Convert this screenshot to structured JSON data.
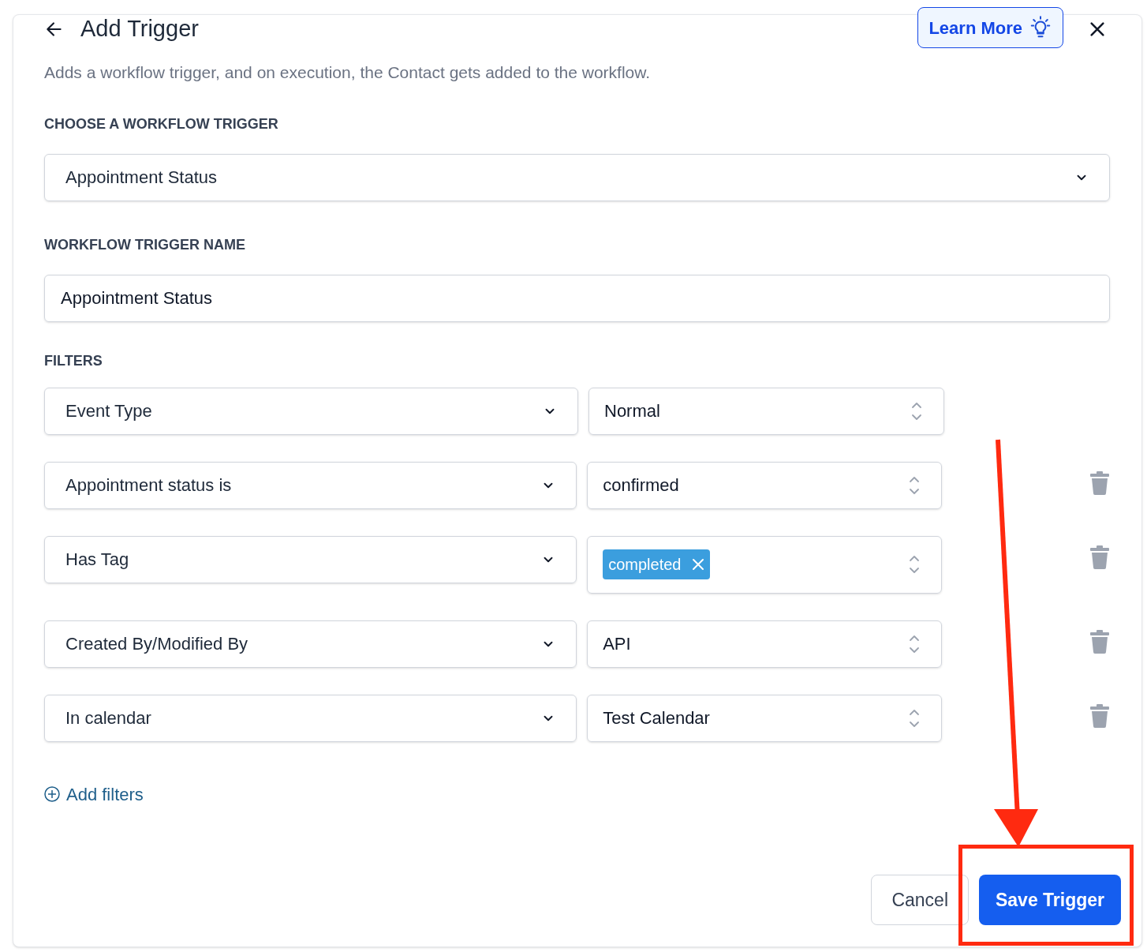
{
  "header": {
    "title": "Add Trigger",
    "learn_more": "Learn More",
    "description": "Adds a workflow trigger, and on execution, the Contact gets added to the workflow."
  },
  "trigger_section": {
    "label": "CHOOSE A WORKFLOW TRIGGER",
    "value": "Appointment Status"
  },
  "name_section": {
    "label": "WORKFLOW TRIGGER NAME",
    "value": "Appointment Status"
  },
  "filters": {
    "label": "FILTERS",
    "rows": [
      {
        "field": "Event Type",
        "kind": "select",
        "value": "Normal",
        "removable": false
      },
      {
        "field": "Appointment status is",
        "kind": "select",
        "value": "confirmed",
        "removable": true
      },
      {
        "field": "Has Tag",
        "kind": "tags",
        "tags": [
          "completed"
        ],
        "removable": true
      },
      {
        "field": "Created By/Modified By",
        "kind": "select",
        "value": "API",
        "removable": true
      },
      {
        "field": "In calendar",
        "kind": "select",
        "value": "Test Calendar",
        "removable": true
      }
    ],
    "add_label": "Add filters"
  },
  "footer": {
    "cancel": "Cancel",
    "save": "Save Trigger"
  }
}
